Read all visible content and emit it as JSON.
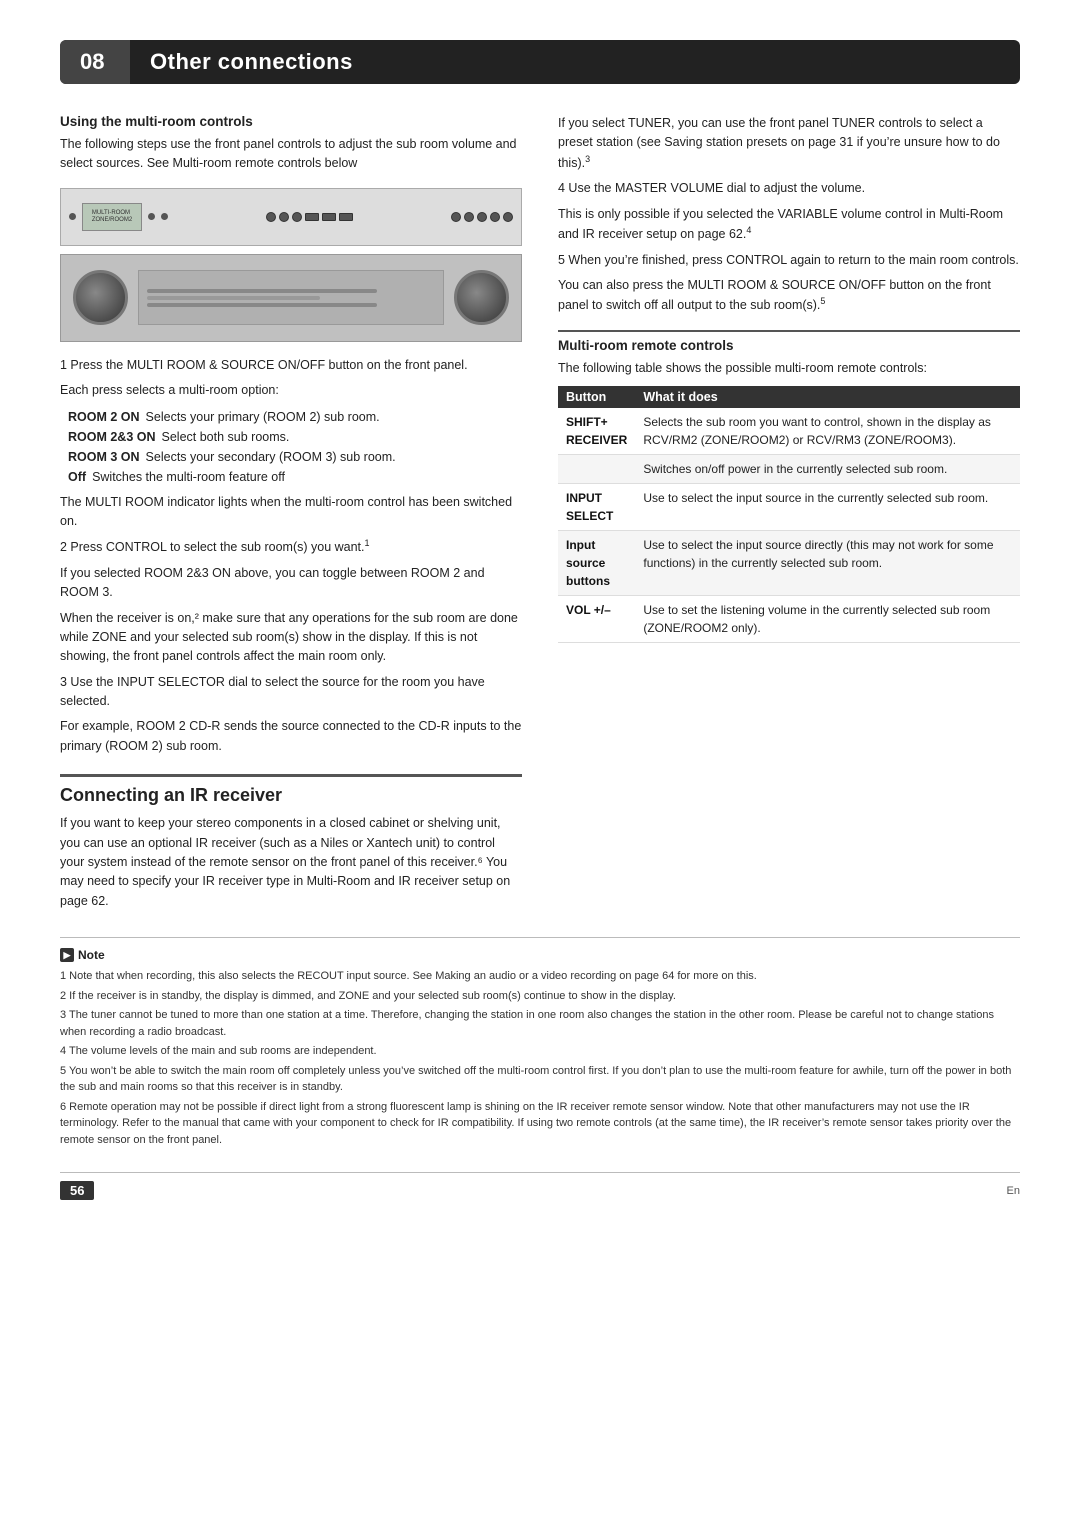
{
  "header": {
    "number": "08",
    "title": "Other connections"
  },
  "left_col": {
    "section1_heading": "Using the multi-room controls",
    "section1_intro": "The following steps use the front panel controls to adjust the sub room volume and select sources. See Multi-room remote controls below",
    "step1": "1   Press the MULTI ROOM & SOURCE ON/OFF button on the front panel.",
    "step1a": "Each press selects a multi-room option:",
    "rooms": [
      {
        "label": "ROOM 2 ON",
        "desc": "Selects your primary (ROOM 2) sub room."
      },
      {
        "label": "ROOM 2&3 ON",
        "desc": "Select both sub rooms."
      },
      {
        "label": "ROOM 3 ON",
        "desc": "Selects your secondary (ROOM 3) sub room."
      },
      {
        "label": "Off",
        "desc": "Switches the multi-room feature off"
      }
    ],
    "multi_room_note": "The MULTI ROOM indicator lights when the multi-room control has been switched on.",
    "step2": "2   Press CONTROL to select the sub room(s) you want.",
    "step2_sup": "1",
    "step2a": "If you selected ROOM 2&3 ON above, you can toggle between ROOM 2 and ROOM 3.",
    "step2b": "When the receiver is on,² make sure that any operations for the sub room are done while ZONE and your selected sub room(s) show in the display. If this is not showing, the front panel controls affect the main room only.",
    "step3": "3   Use the INPUT SELECTOR dial to select the source for the room you have selected.",
    "step3a": "For example, ROOM 2 CD-R sends the source connected to the CD-R inputs to the primary (ROOM 2) sub room.",
    "ir_heading": "Connecting an IR receiver",
    "ir_body": "If you want to keep your stereo components in a closed cabinet or shelving unit, you can use an optional IR receiver (such as a Niles or Xantech unit) to control your system instead of the remote sensor on the front panel of this receiver.⁶ You may need to specify your IR receiver type in Multi-Room and IR receiver setup on page 62."
  },
  "right_col": {
    "tuner_note": "If you select TUNER, you can use the front panel TUNER controls to select a preset station (see Saving station presets on page 31 if you’re unsure how to do this).",
    "tuner_note_sup": "3",
    "step4": "4   Use the MASTER VOLUME dial to adjust the volume.",
    "step4a": "This is only possible if you selected the VARIABLE volume control in Multi-Room and IR receiver setup on page 62.",
    "step4_sup": "4",
    "step5": "5   When you’re finished, press CONTROL again to return to the main room controls.",
    "step5a": "You can also press the MULTI ROOM & SOURCE ON/OFF button on the front panel to switch off all output to the sub room(s).",
    "step5_sup": "5",
    "mr_heading": "Multi-room remote controls",
    "mr_intro": "The following table shows the possible multi-room remote controls:",
    "table": {
      "headers": [
        "Button",
        "What it does"
      ],
      "rows": [
        {
          "button": "SHIFT+\nRECEIVER",
          "desc": "Selects the sub room you want to control, shown in the display as RCV/RM2 (ZONE/ROOM2) or RCV/RM3 (ZONE/ROOM3)."
        },
        {
          "button": "",
          "desc": "Switches on/off power in the currently selected sub room."
        },
        {
          "button": "INPUT\nSELECT",
          "desc": "Use to select the input source in the currently selected sub room."
        },
        {
          "button": "Input\nsource\nbuttons",
          "desc": "Use to select the input source directly (this may not work for some functions) in the currently selected sub room."
        },
        {
          "button": "VOL +/–",
          "desc": "Use to set the listening volume in the currently selected sub room (ZONE/ROOM2 only)."
        }
      ]
    }
  },
  "notes": {
    "heading": "Note",
    "items": [
      "1  Note that when recording, this also selects the RECOUT input source. See Making an audio or a video recording on page 64 for more on this.",
      "2  If the receiver is in standby, the display is dimmed, and ZONE and your selected sub room(s) continue to show in the display.",
      "3  The tuner cannot be tuned to more than one station at a time. Therefore, changing the station in one room also changes the station in the other room. Please be careful not to change stations when recording a radio broadcast.",
      "4  The volume levels of the main and sub rooms are independent.",
      "5  You won’t be able to switch the main room off completely unless you’ve switched off the multi-room control first. If you don’t plan to use the multi-room feature for awhile, turn off the power in both the sub and main rooms so that this receiver is in standby.",
      "6  Remote operation may not be possible if direct light from a strong fluorescent lamp is shining on the IR receiver remote sensor window. Note that other manufacturers may not use the IR terminology. Refer to the manual that came with your component to check for IR compatibility. If using two remote controls (at the same time), the IR receiver’s remote sensor takes priority over the remote sensor on the front panel."
    ]
  },
  "footer": {
    "page_number": "56",
    "lang": "En"
  }
}
